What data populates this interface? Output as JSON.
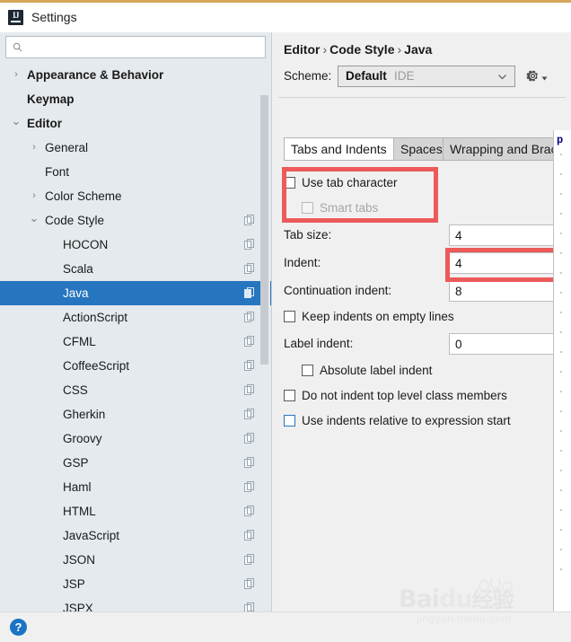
{
  "window": {
    "title": "Settings",
    "app_icon": "intellij-idea-icon",
    "accent_color": "#d6a75a"
  },
  "search": {
    "value": "",
    "placeholder": "",
    "icon": "search-icon"
  },
  "sidebar": {
    "selected": "Java",
    "selection_color": "#2675bf",
    "items": [
      {
        "label": "Appearance & Behavior",
        "depth": 0,
        "arrow": "collapsed",
        "bold": true,
        "copy_icon": false
      },
      {
        "label": "Keymap",
        "depth": 0,
        "arrow": "none",
        "bold": true,
        "copy_icon": false
      },
      {
        "label": "Editor",
        "depth": 0,
        "arrow": "expanded",
        "bold": true,
        "copy_icon": false
      },
      {
        "label": "General",
        "depth": 1,
        "arrow": "collapsed",
        "bold": false,
        "copy_icon": false
      },
      {
        "label": "Font",
        "depth": 1,
        "arrow": "none",
        "bold": false,
        "copy_icon": false
      },
      {
        "label": "Color Scheme",
        "depth": 1,
        "arrow": "collapsed",
        "bold": false,
        "copy_icon": false
      },
      {
        "label": "Code Style",
        "depth": 1,
        "arrow": "expanded",
        "bold": false,
        "copy_icon": true
      },
      {
        "label": "HOCON",
        "depth": 2,
        "arrow": "none",
        "bold": false,
        "copy_icon": true
      },
      {
        "label": "Scala",
        "depth": 2,
        "arrow": "none",
        "bold": false,
        "copy_icon": true
      },
      {
        "label": "Java",
        "depth": 2,
        "arrow": "none",
        "bold": false,
        "copy_icon": true
      },
      {
        "label": "ActionScript",
        "depth": 2,
        "arrow": "none",
        "bold": false,
        "copy_icon": true
      },
      {
        "label": "CFML",
        "depth": 2,
        "arrow": "none",
        "bold": false,
        "copy_icon": true
      },
      {
        "label": "CoffeeScript",
        "depth": 2,
        "arrow": "none",
        "bold": false,
        "copy_icon": true
      },
      {
        "label": "CSS",
        "depth": 2,
        "arrow": "none",
        "bold": false,
        "copy_icon": true
      },
      {
        "label": "Gherkin",
        "depth": 2,
        "arrow": "none",
        "bold": false,
        "copy_icon": true
      },
      {
        "label": "Groovy",
        "depth": 2,
        "arrow": "none",
        "bold": false,
        "copy_icon": true
      },
      {
        "label": "GSP",
        "depth": 2,
        "arrow": "none",
        "bold": false,
        "copy_icon": true
      },
      {
        "label": "Haml",
        "depth": 2,
        "arrow": "none",
        "bold": false,
        "copy_icon": true
      },
      {
        "label": "HTML",
        "depth": 2,
        "arrow": "none",
        "bold": false,
        "copy_icon": true
      },
      {
        "label": "JavaScript",
        "depth": 2,
        "arrow": "none",
        "bold": false,
        "copy_icon": true
      },
      {
        "label": "JSON",
        "depth": 2,
        "arrow": "none",
        "bold": false,
        "copy_icon": true
      },
      {
        "label": "JSP",
        "depth": 2,
        "arrow": "none",
        "bold": false,
        "copy_icon": true
      },
      {
        "label": "JSPX",
        "depth": 2,
        "arrow": "none",
        "bold": false,
        "copy_icon": true
      }
    ]
  },
  "main": {
    "breadcrumb": {
      "part1": "Editor",
      "part2": "Code Style",
      "part3": "Java",
      "separator": "›"
    },
    "scheme": {
      "label": "Scheme:",
      "name": "Default",
      "scope": "IDE",
      "chevron": "chevron-down-icon",
      "gear": "gear-icon"
    },
    "tabs": [
      {
        "label": "Tabs and Indents",
        "active": true
      },
      {
        "label": "Spaces",
        "active": false
      },
      {
        "label": "Wrapping and Brace",
        "active": false
      }
    ],
    "fields": {
      "use_tab_character": {
        "label": "Use tab character",
        "checked": false,
        "disabled": false
      },
      "smart_tabs": {
        "label": "Smart tabs",
        "checked": false,
        "disabled": true
      },
      "tab_size": {
        "label": "Tab size:",
        "value": "4"
      },
      "indent": {
        "label": "Indent:",
        "value": "4"
      },
      "continuation_indent": {
        "label": "Continuation indent:",
        "value": "8"
      },
      "keep_indents": {
        "label": "Keep indents on empty lines",
        "checked": false
      },
      "label_indent": {
        "label": "Label indent:",
        "value": "0"
      },
      "absolute_label_indent": {
        "label": "Absolute label indent",
        "checked": false
      },
      "no_indent_top_level": {
        "label": "Do not indent top level class members",
        "checked": false
      },
      "relative_indents": {
        "label": "Use indents relative to expression start",
        "checked": false,
        "focused": true
      }
    },
    "annotations": {
      "color": "#ec5a5a",
      "box1_target": "use-tab-character-group",
      "box2_target": "indent-field"
    },
    "preview": {
      "snippet": "p"
    }
  },
  "bottom": {
    "help_icon": "help-icon",
    "help_label": "?"
  },
  "watermark": {
    "main": "Bai",
    "main2": "du",
    "cn": "经验",
    "sub": "jingyan.baidu.com"
  }
}
